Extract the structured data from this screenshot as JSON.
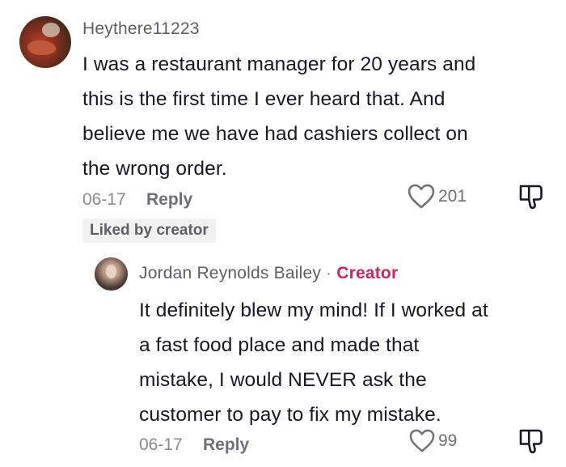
{
  "main_comment": {
    "username": "Heythere11223",
    "lines": [
      "I was a restaurant manager for 20 years and",
      "this is the first time I ever heard that. And",
      "believe me we have had cashiers collect on",
      "the wrong order."
    ],
    "date": "06-17",
    "reply_label": "Reply",
    "likes": "201",
    "liked_by_creator": "Liked by creator"
  },
  "reply_comment": {
    "username": "Jordan Reynolds Bailey",
    "separator": "·",
    "creator_label": "Creator",
    "lines": [
      "It definitely blew my mind! If I worked at",
      "a fast food place and made that",
      "mistake, I would NEVER ask the",
      "customer to pay to fix my mistake."
    ],
    "date": "06-17",
    "reply_label": "Reply",
    "likes": "99"
  },
  "icons": {
    "like": "heart-outline-icon",
    "dislike": "thumbs-down-outline-icon"
  },
  "colors": {
    "creator_accent": "#c6295b",
    "text": "#161823",
    "muted": "#8a8b91"
  }
}
